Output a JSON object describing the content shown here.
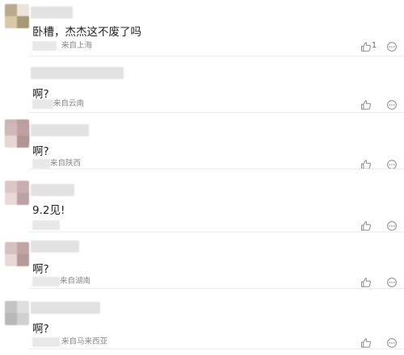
{
  "comments": [
    {
      "text": "卧槽，杰杰这不废了吗",
      "location": "来自上海",
      "likes": "1",
      "avatar_colors": [
        "#b9a98d",
        "#ece4d8",
        "#d8c8a8",
        "#a89878"
      ]
    },
    {
      "text": "啊?",
      "location": "来自云南",
      "likes": "",
      "avatar_colors": [
        "#c9b3b3",
        "#b89d9d",
        "#e0cfcf",
        "#a58787"
      ]
    },
    {
      "text": "啊?",
      "location": "来自陕西",
      "likes": "",
      "avatar_colors": [
        "#d2b9b9",
        "#bfa0a0",
        "#e6d6d6",
        "#b39494"
      ]
    },
    {
      "text": "9.2见!",
      "location": "",
      "likes": "",
      "avatar_colors": [
        "#dcc7c7",
        "#c8aeae",
        "#ead9d9",
        "#bca2a2"
      ]
    },
    {
      "text": "啊?",
      "location": "来自湖南",
      "likes": "",
      "avatar_colors": [
        "#d6c0c0",
        "#c2a4a4",
        "#e8d8d8",
        "#b69999"
      ]
    },
    {
      "text": "啊?",
      "location": "来自马来西亚",
      "likes": "",
      "avatar_colors": [
        "#c4c4c4",
        "#dedede",
        "#b8b8b8",
        "#d0d0d0"
      ]
    }
  ]
}
